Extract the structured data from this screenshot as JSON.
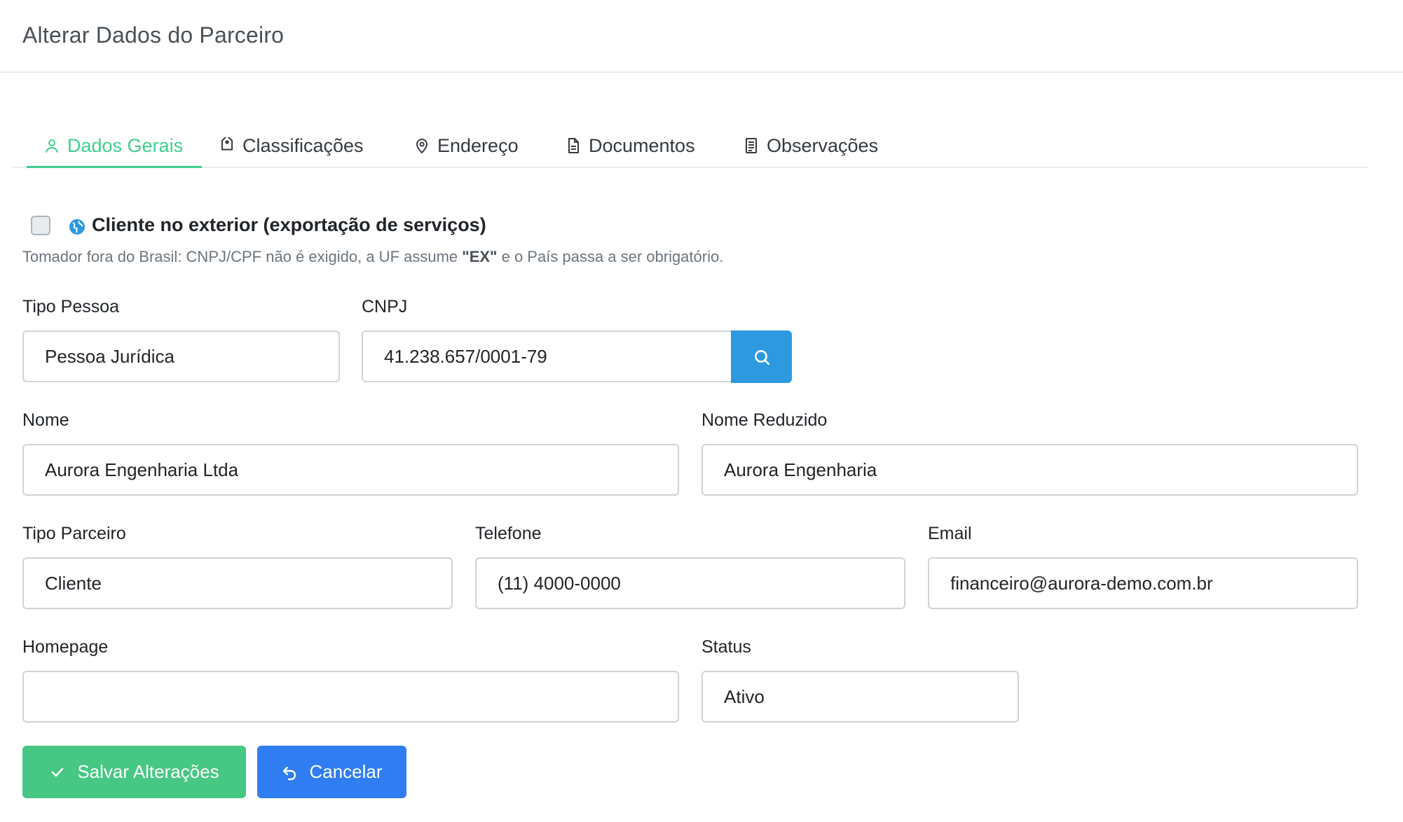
{
  "header": {
    "title": "Alterar Dados do Parceiro"
  },
  "tabs": [
    {
      "label": "Dados Gerais",
      "icon": "user-icon",
      "active": true
    },
    {
      "label": "Classificações",
      "icon": "tag-icon",
      "active": false
    },
    {
      "label": "Endereço",
      "icon": "map-pin-icon",
      "active": false
    },
    {
      "label": "Documentos",
      "icon": "document-icon",
      "active": false
    },
    {
      "label": "Observações",
      "icon": "notes-icon",
      "active": false
    }
  ],
  "export": {
    "checked": false,
    "label": "Cliente no exterior (exportação de serviços)",
    "hint_before": "Tomador fora do Brasil: CNPJ/CPF não é exigido, a UF assume ",
    "hint_bold": "\"EX\"",
    "hint_after": " e o País passa a ser obrigatório."
  },
  "fields": {
    "tipo_pessoa": {
      "label": "Tipo Pessoa",
      "value": "Pessoa Jurídica"
    },
    "cnpj": {
      "label": "CNPJ",
      "value": "41.238.657/0001-79"
    },
    "nome": {
      "label": "Nome",
      "value": "Aurora Engenharia Ltda"
    },
    "nome_reduzido": {
      "label": "Nome Reduzido",
      "value": "Aurora Engenharia"
    },
    "tipo_parceiro": {
      "label": "Tipo Parceiro",
      "value": "Cliente"
    },
    "telefone": {
      "label": "Telefone",
      "value": "(11) 4000-0000"
    },
    "email": {
      "label": "Email",
      "value": "financeiro@aurora-demo.com.br"
    },
    "homepage": {
      "label": "Homepage",
      "value": ""
    },
    "status": {
      "label": "Status",
      "value": "Ativo"
    }
  },
  "buttons": {
    "save_label": "Salvar Alterações",
    "cancel_label": "Cancelar"
  },
  "colors": {
    "accent_green": "#3ecf8e",
    "save_green": "#47c784",
    "cancel_blue": "#2f7df0",
    "search_blue": "#2d9ae0"
  }
}
